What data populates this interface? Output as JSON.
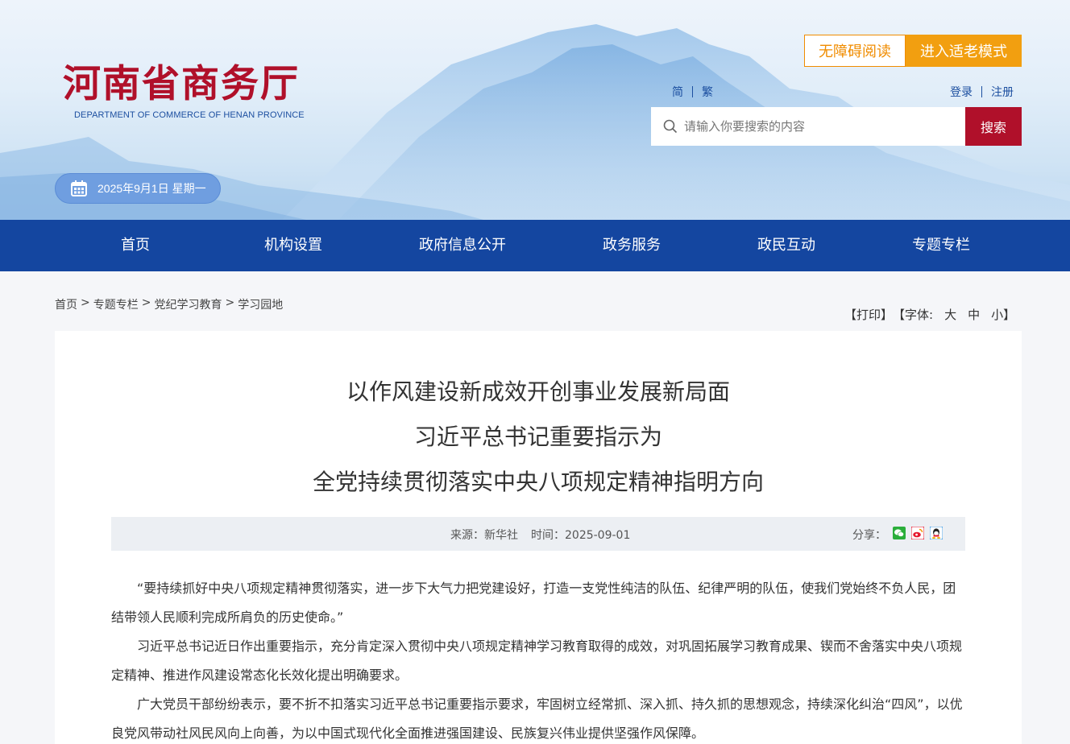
{
  "header": {
    "logo_title": "河南省商务厅",
    "logo_subtitle": "DEPARTMENT OF COMMERCE OF HENAN PROVINCE",
    "date": "2025年9月1日 星期一",
    "accessibility_label": "无障碍阅读",
    "elder_mode_label": "进入适老模式",
    "lang_simplified": "简",
    "lang_traditional": "繁",
    "login": "登录",
    "register": "注册",
    "search_placeholder": "请输入你要搜索的内容",
    "search_button": "搜索"
  },
  "nav": {
    "items": [
      {
        "label": "首页"
      },
      {
        "label": "机构设置"
      },
      {
        "label": "政府信息公开"
      },
      {
        "label": "政务服务"
      },
      {
        "label": "政民互动"
      },
      {
        "label": "专题专栏"
      }
    ]
  },
  "breadcrumb": {
    "items": [
      "首页",
      "专题专栏",
      "党纪学习教育",
      "学习园地"
    ],
    "separator": ">"
  },
  "tools": {
    "print": "【打印】",
    "font_prefix": "【字体:",
    "font_large": "大",
    "font_medium": "中",
    "font_small": "小",
    "font_suffix": "】"
  },
  "article": {
    "title_lines": [
      "以作风建设新成效开创事业发展新局面",
      "习近平总书记重要指示为",
      "全党持续贯彻落实中央八项规定精神指明方向"
    ],
    "source": "来源：新华社",
    "time": "时间：2025-09-01",
    "share_label": "分享：",
    "paragraphs": [
      "“要持续抓好中央八项规定精神贯彻落实，进一步下大气力把党建设好，打造一支党性纯洁的队伍、纪律严明的队伍，使我们党始终不负人民，团结带领人民顺利完成所肩负的历史使命。”",
      "习近平总书记近日作出重要指示，充分肯定深入贯彻中央八项规定精神学习教育取得的成效，对巩固拓展学习教育成果、锲而不舍落实中央八项规定精神、推进作风建设常态化长效化提出明确要求。",
      "广大党员干部纷纷表示，要不折不扣落实习近平总书记重要指示要求，牢固树立经常抓、深入抓、持久抓的思想观念，持续深化纠治“四风”，以优良党风带动社风民风向上向善，为以中国式现代化全面推进强国建设、民族复兴伟业提供坚强作风保障。"
    ]
  },
  "colors": {
    "brand_red": "#b0102a",
    "nav_blue": "#1446a0",
    "accent_orange": "#f29f10"
  },
  "icons": {
    "calendar": "calendar-icon",
    "search": "search-icon",
    "wechat": "wechat-icon",
    "weibo": "weibo-icon",
    "qq": "qq-icon"
  }
}
